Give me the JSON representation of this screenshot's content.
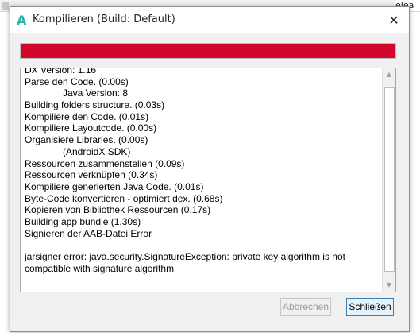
{
  "background": {
    "tab_text": "elea"
  },
  "dialog": {
    "title": "Kompilieren (Build: Default)",
    "app_icon_glyph": "A",
    "app_icon_color": "#2bb3a6",
    "close_glyph": "✕"
  },
  "progress": {
    "value": 1.0,
    "color": "#d2062a"
  },
  "log": {
    "lines": [
      {
        "text": "DX Version: 1.16",
        "indent": false
      },
      {
        "text": "Parse den Code.    (0.00s)",
        "indent": false
      },
      {
        "text": "Java Version: 8",
        "indent": true
      },
      {
        "text": "Building folders structure.    (0.03s)",
        "indent": false
      },
      {
        "text": "Kompiliere den Code.    (0.01s)",
        "indent": false
      },
      {
        "text": "Kompiliere Layoutcode.    (0.00s)",
        "indent": false
      },
      {
        "text": "Organisiere Libraries.    (0.00s)",
        "indent": false
      },
      {
        "text": "(AndroidX SDK)",
        "indent": true
      },
      {
        "text": "Ressourcen zusammenstellen    (0.09s)",
        "indent": false
      },
      {
        "text": "Ressourcen verknüpfen    (0.34s)",
        "indent": false
      },
      {
        "text": "Kompiliere generierten Java Code.    (0.01s)",
        "indent": false
      },
      {
        "text": "Byte-Code konvertieren - optimiert dex.    (0.68s)",
        "indent": false
      },
      {
        "text": "Kopieren von Bibliothek Ressourcen    (0.17s)",
        "indent": false
      },
      {
        "text": "Building app bundle    (1.30s)",
        "indent": false
      },
      {
        "text": "Signieren der AAB-Datei    Error",
        "indent": false
      },
      {
        "text": "",
        "indent": false
      },
      {
        "text": "jarsigner error: java.security.SignatureException: private key algorithm is not compatible with signature algorithm",
        "indent": false,
        "wrap": true
      }
    ]
  },
  "buttons": {
    "cancel_label": "Abbrechen",
    "close_label": "Schließen"
  },
  "scrollbar": {
    "up_glyph": "▲",
    "down_glyph": "▼"
  }
}
